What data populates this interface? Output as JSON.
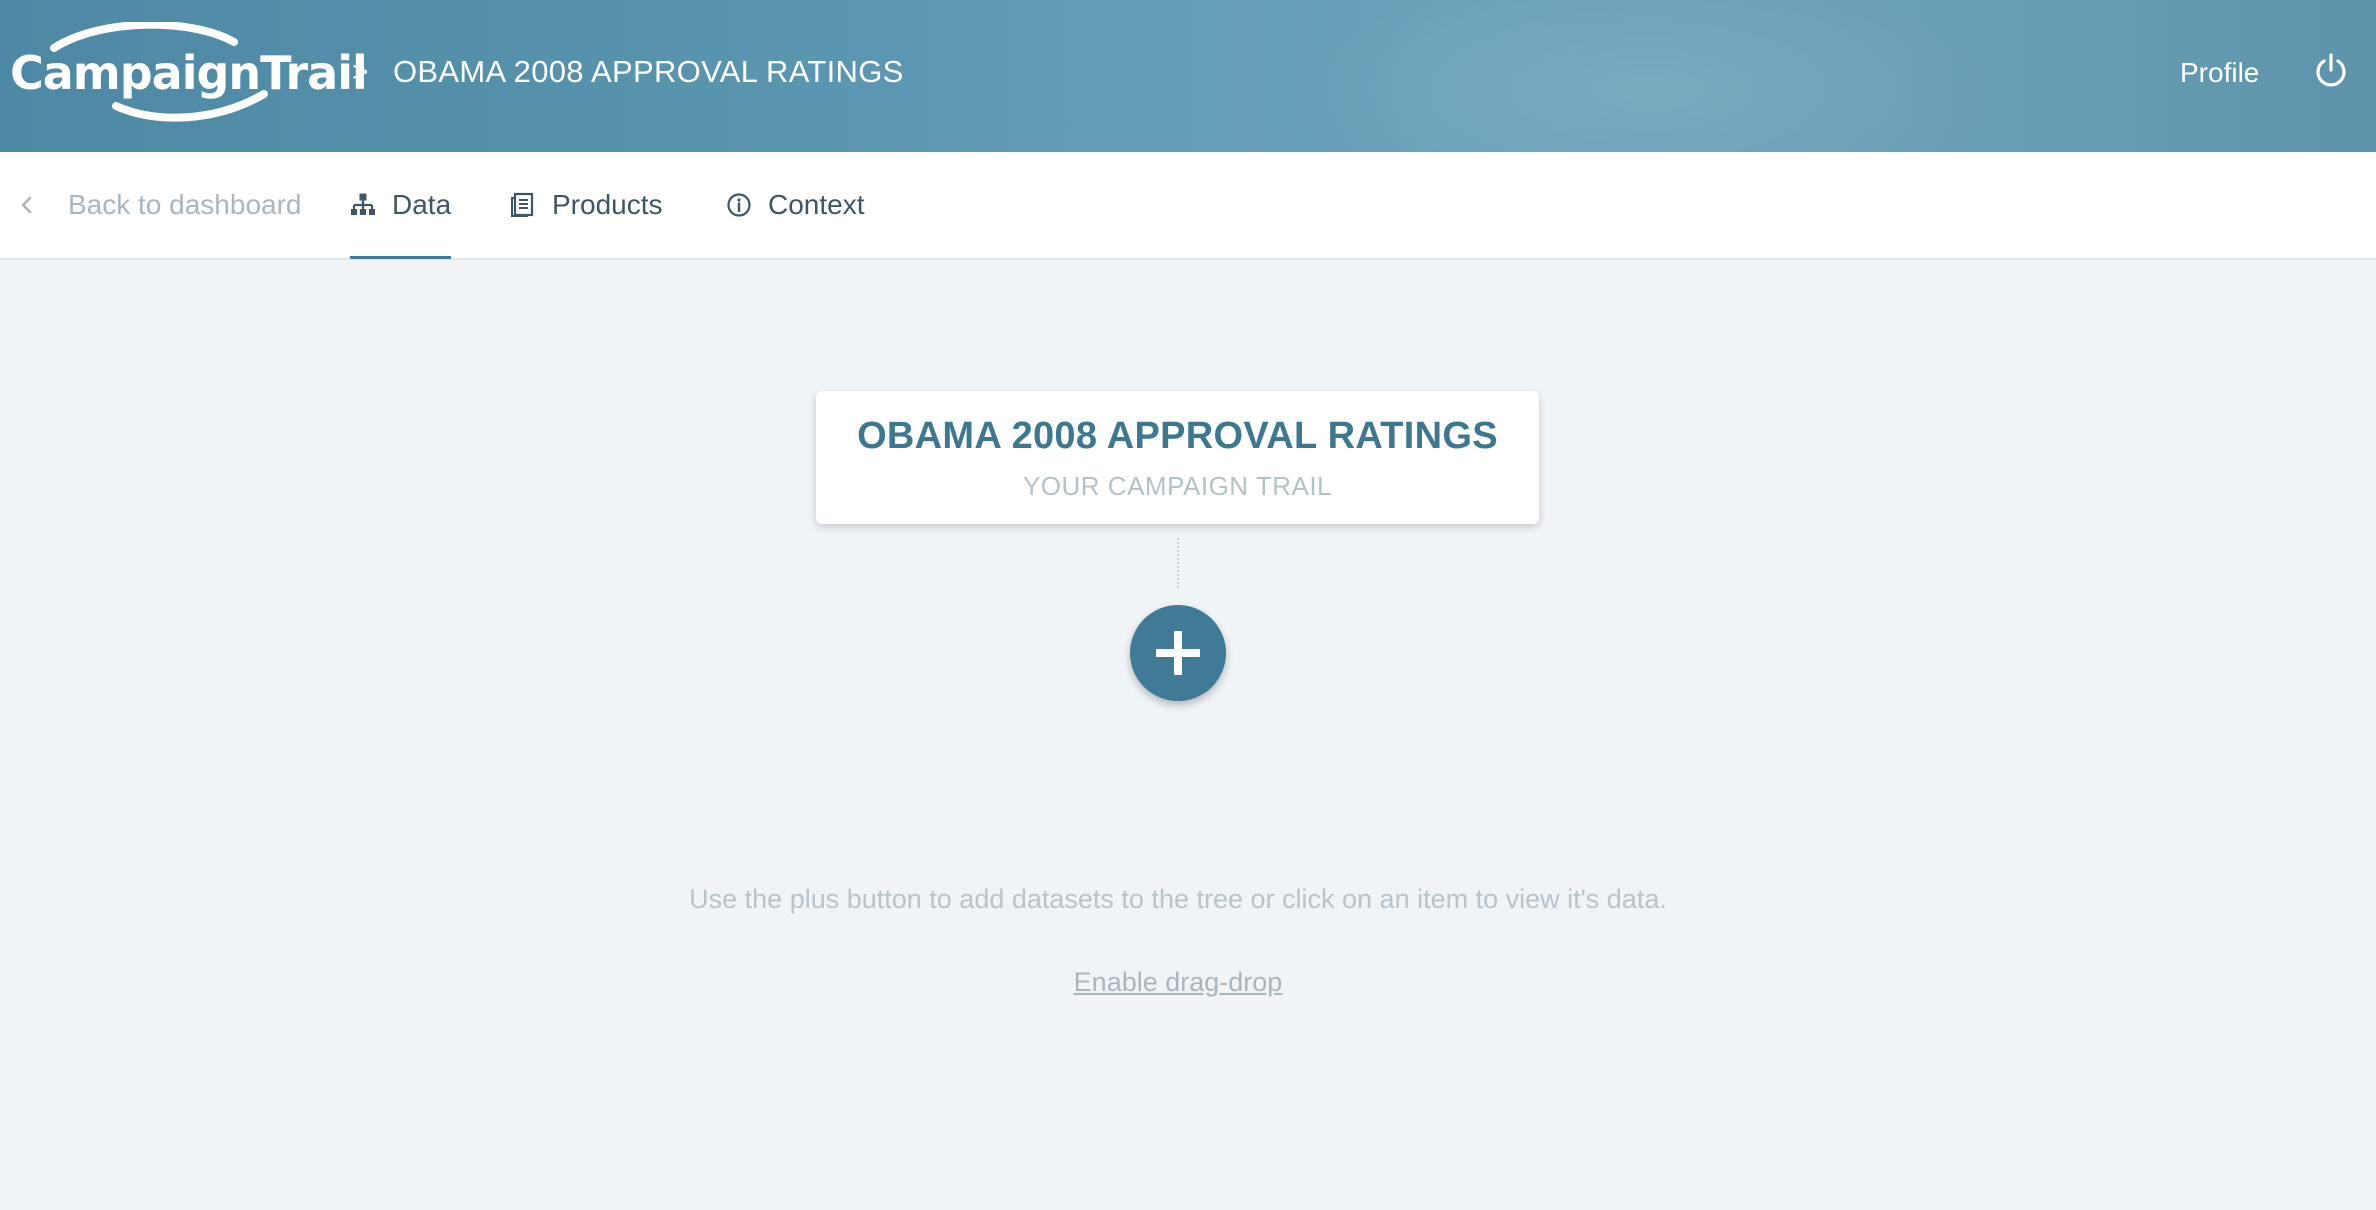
{
  "header": {
    "logo_text": "CampaignTrail",
    "breadcrumb_separator": ">",
    "project_title": "OBAMA 2008 APPROVAL RATINGS",
    "profile_label": "Profile"
  },
  "tabs": {
    "back_label": "Back to dashboard",
    "items": [
      {
        "label": "Data",
        "icon": "sitemap-icon",
        "active": true
      },
      {
        "label": "Products",
        "icon": "document-icon",
        "active": false
      },
      {
        "label": "Context",
        "icon": "info-icon",
        "active": false
      }
    ]
  },
  "tree": {
    "root_title": "OBAMA 2008 APPROVAL RATINGS",
    "root_subtitle": "YOUR CAMPAIGN TRAIL"
  },
  "empty_state": {
    "hint": "Use the plus button to add datasets to the tree or click on an item to view it's data.",
    "drag_drop_link": "Enable drag-drop"
  },
  "colors": {
    "accent": "#3f7a97",
    "header": "#5b96b0",
    "background": "#f0f4f7"
  }
}
